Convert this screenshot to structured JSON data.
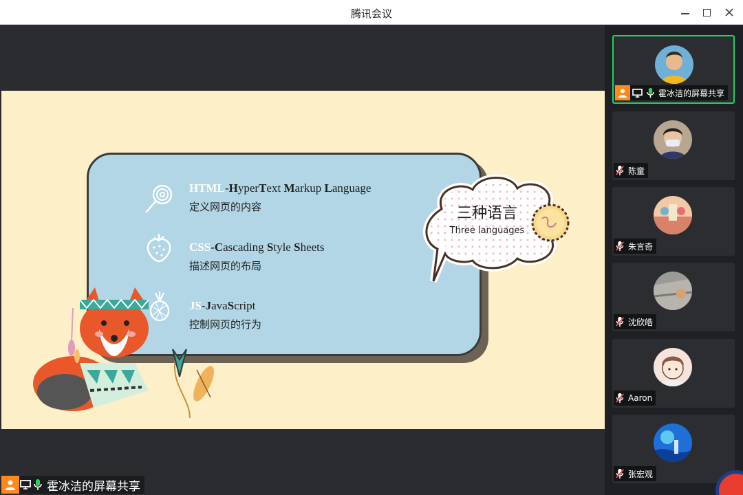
{
  "window": {
    "title": "腾讯会议",
    "minimize_label": "minimize",
    "maximize_label": "maximize",
    "close_label": "close"
  },
  "slide": {
    "languages": [
      {
        "abbr": "HTML",
        "full": [
          "-",
          "H",
          "yper",
          "T",
          "ext ",
          "M",
          "arkup ",
          "L",
          "anguage"
        ],
        "desc": "定义网页的内容",
        "icon": "lollipop-icon"
      },
      {
        "abbr": "CSS",
        "full": [
          "-",
          "C",
          "ascading ",
          "S",
          "tyle ",
          "S",
          "heets"
        ],
        "desc": "描述网页的布局",
        "icon": "strawberry-icon"
      },
      {
        "abbr": "JS",
        "full": [
          "-",
          "J",
          "ava",
          "S",
          "cript"
        ],
        "desc": "控制网页的行为",
        "icon": "pineapple-icon"
      }
    ],
    "bubble_title": "三种语言",
    "bubble_subtitle": "Three languages",
    "colors": {
      "background": "#fdf0c8",
      "card": "#b2d6e6",
      "accent_fox": "#e9582a"
    }
  },
  "share_label": {
    "name": "霍冰洁的屏幕共享",
    "icons": [
      "user-icon",
      "screen-share-icon",
      "mic-on-icon"
    ]
  },
  "participants": [
    {
      "name": "霍冰洁的屏幕共享",
      "sharing": true,
      "muted": false,
      "active": true
    },
    {
      "name": "陈童",
      "sharing": false,
      "muted": true,
      "active": false
    },
    {
      "name": "朱言奇",
      "sharing": false,
      "muted": true,
      "active": false
    },
    {
      "name": "沈欣皓",
      "sharing": false,
      "muted": true,
      "active": false
    },
    {
      "name": "Aaron",
      "sharing": false,
      "muted": true,
      "active": false
    },
    {
      "name": "张宏观",
      "sharing": false,
      "muted": true,
      "active": false
    }
  ]
}
